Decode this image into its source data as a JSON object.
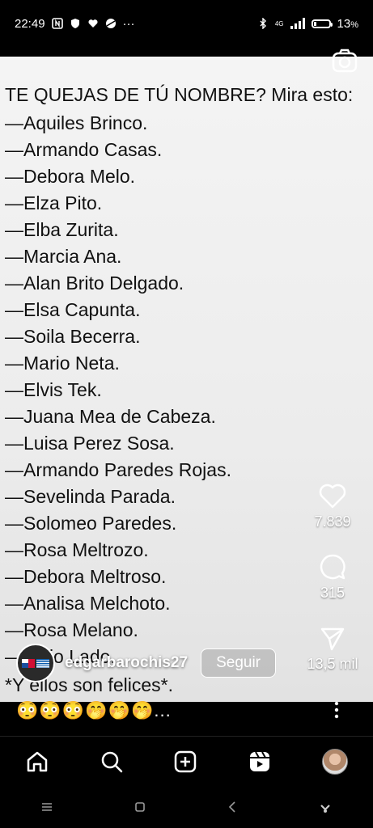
{
  "status_bar": {
    "time": "22:49",
    "battery": "13",
    "battery_unit": "%",
    "signal_label": "4G",
    "more": "···"
  },
  "post": {
    "title": "TE QUEJAS DE TÚ NOMBRE? Mira esto:",
    "names": [
      "—Aquiles Brinco.",
      "—Armando Casas.",
      "—Debora Melo.",
      "—Elza Pito.",
      "—Elba Zurita.",
      "—Marcia Ana.",
      "—Alan Brito Delgado.",
      "—Elsa Capunta.",
      "—Soila Becerra.",
      "—Mario Neta.",
      "—Elvis Tek.",
      "—Juana Mea de Cabeza.",
      "—Luisa Perez Sosa.",
      "—Armando Paredes Rojas.",
      "—Sevelinda Parada.",
      "—Solomeo Paredes.",
      "—Rosa Meltrozo.",
      "—Debora Meltroso.",
      "—Analisa Melchoto.",
      "—Rosa Melano.",
      "—Elvio Lado."
    ],
    "footer": "*Y ellos son felices*."
  },
  "actions": {
    "likes": "7.839",
    "comments": "315",
    "shares": "13,5 mil"
  },
  "user": {
    "username": "edgarbarochis27",
    "follow_label": "Seguir"
  },
  "caption": "😳😳😳🤭🤭🤭...",
  "colors": {
    "background": "#000000",
    "post_bg": "#eeeeee",
    "text": "#111111"
  }
}
